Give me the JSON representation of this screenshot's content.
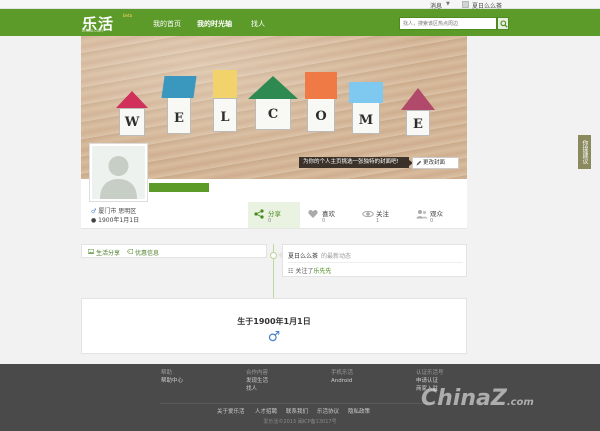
{
  "topbar": {
    "messages_label": "消息",
    "username": "夏日么么茶"
  },
  "brand": {
    "logo_text": "乐活",
    "beta": "beta",
    "domain": "lehuo.com"
  },
  "nav": {
    "items": [
      {
        "label": "我的首页",
        "active": false
      },
      {
        "label": "我的时光轴",
        "active": true
      },
      {
        "label": "找人",
        "active": false
      }
    ]
  },
  "search": {
    "placeholder": "找人，搜索该区热点周边"
  },
  "cover": {
    "letters": [
      "W",
      "E",
      "L",
      "C",
      "O",
      "M",
      "E"
    ],
    "hint": "为你的个人主页挑选一张独特的封面吧!",
    "change_button": "更改封面"
  },
  "side_tab": {
    "label": "你提建议"
  },
  "profile": {
    "location": "厦门市 思明区",
    "birthday": "1900年1月1日"
  },
  "stats": [
    {
      "label": "分享",
      "count": "0",
      "icon": "share-icon",
      "active": true
    },
    {
      "label": "喜欢",
      "count": "0",
      "icon": "heart-icon",
      "active": false
    },
    {
      "label": "关注",
      "count": "1",
      "icon": "eye-icon",
      "active": false
    },
    {
      "label": "观众",
      "count": "0",
      "icon": "people-icon",
      "active": false
    }
  ],
  "tabs": {
    "life_share": "生活分享",
    "discount": "优惠信息"
  },
  "activity": {
    "user": "夏日么么茶",
    "subtitle": "的最新动态",
    "follow_prefix": "关注了",
    "follow_target": "乐先先"
  },
  "birth_card": {
    "text": "生于1900年1月1日",
    "gender_symbol": "♂"
  },
  "footer": {
    "columns": [
      {
        "head": "帮助",
        "items": [
          "帮助中心"
        ]
      },
      {
        "head": "合作内容",
        "items": [
          "发现生活",
          "找人"
        ]
      },
      {
        "head": "手机乐活",
        "items": [
          "Android"
        ]
      },
      {
        "head": "认证乐活号",
        "items": [
          "申请认证",
          "商家入驻"
        ]
      }
    ],
    "links": [
      "关于爱乐活",
      "人才招聘",
      "联系我们",
      "乐活协议",
      "隐私政策"
    ],
    "copyright": "爱乐活©2013 闽ICP备13017号"
  },
  "watermark": {
    "main": "ChinaZ",
    "sub": ".com"
  },
  "colors": {
    "brand_green": "#5c9b2a",
    "footer_bg": "#4a4a4a",
    "link_blue": "#4a82c8"
  }
}
